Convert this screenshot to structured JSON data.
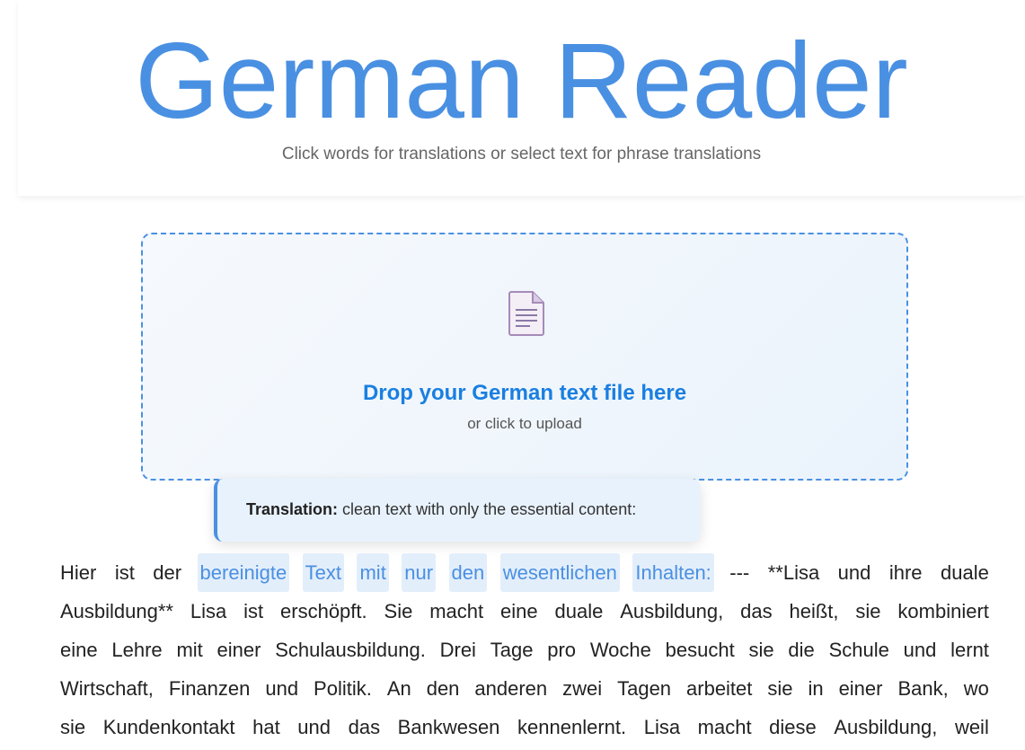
{
  "header": {
    "title": "German Reader",
    "subtitle": "Click words for translations or select text for phrase translations"
  },
  "upload": {
    "icon": "document-icon",
    "title": "Drop your German text file here",
    "subtitle": "or click to upload"
  },
  "tooltip": {
    "label": "Translation:",
    "text": " clean text with only the essential content:"
  },
  "reader": {
    "lines": [
      [
        {
          "w": "Hier",
          "hl": false
        },
        {
          "w": "ist",
          "hl": false
        },
        {
          "w": "der",
          "hl": false
        },
        {
          "w": "bereinigte",
          "hl": true
        },
        {
          "w": "Text",
          "hl": true
        },
        {
          "w": "mit",
          "hl": true
        },
        {
          "w": "nur",
          "hl": true
        },
        {
          "w": "den",
          "hl": true
        },
        {
          "w": "wesentlichen",
          "hl": true
        },
        {
          "w": "Inhalten:",
          "hl": true
        },
        {
          "w": "---",
          "hl": false
        },
        {
          "w": "**Lisa",
          "hl": false
        },
        {
          "w": "und",
          "hl": false
        },
        {
          "w": "ihre",
          "hl": false
        },
        {
          "w": "duale",
          "hl": false
        }
      ],
      [
        {
          "w": "Ausbildung**",
          "hl": false
        },
        {
          "w": "Lisa",
          "hl": false
        },
        {
          "w": "ist",
          "hl": false
        },
        {
          "w": "erschöpft.",
          "hl": false
        },
        {
          "w": "Sie",
          "hl": false
        },
        {
          "w": "macht",
          "hl": false
        },
        {
          "w": "eine",
          "hl": false
        },
        {
          "w": "duale",
          "hl": false
        },
        {
          "w": "Ausbildung,",
          "hl": false
        },
        {
          "w": "das",
          "hl": false
        },
        {
          "w": "heißt,",
          "hl": false
        },
        {
          "w": "sie",
          "hl": false
        },
        {
          "w": "kombiniert",
          "hl": false
        }
      ],
      [
        {
          "w": "eine",
          "hl": false
        },
        {
          "w": "Lehre",
          "hl": false
        },
        {
          "w": "mit",
          "hl": false
        },
        {
          "w": "einer",
          "hl": false
        },
        {
          "w": "Schulausbildung.",
          "hl": false
        },
        {
          "w": "Drei",
          "hl": false
        },
        {
          "w": "Tage",
          "hl": false
        },
        {
          "w": "pro",
          "hl": false
        },
        {
          "w": "Woche",
          "hl": false
        },
        {
          "w": "besucht",
          "hl": false
        },
        {
          "w": "sie",
          "hl": false
        },
        {
          "w": "die",
          "hl": false
        },
        {
          "w": "Schule",
          "hl": false
        },
        {
          "w": "und",
          "hl": false
        },
        {
          "w": "lernt",
          "hl": false
        }
      ],
      [
        {
          "w": "Wirtschaft,",
          "hl": false
        },
        {
          "w": "Finanzen",
          "hl": false
        },
        {
          "w": "und",
          "hl": false
        },
        {
          "w": "Politik.",
          "hl": false
        },
        {
          "w": "An",
          "hl": false
        },
        {
          "w": "den",
          "hl": false
        },
        {
          "w": "anderen",
          "hl": false
        },
        {
          "w": "zwei",
          "hl": false
        },
        {
          "w": "Tagen",
          "hl": false
        },
        {
          "w": "arbeitet",
          "hl": false
        },
        {
          "w": "sie",
          "hl": false
        },
        {
          "w": "in",
          "hl": false
        },
        {
          "w": "einer",
          "hl": false
        },
        {
          "w": "Bank,",
          "hl": false
        },
        {
          "w": "wo",
          "hl": false
        }
      ],
      [
        {
          "w": "sie",
          "hl": false
        },
        {
          "w": "Kundenkontakt",
          "hl": false
        },
        {
          "w": "hat",
          "hl": false
        },
        {
          "w": "und",
          "hl": false
        },
        {
          "w": "das",
          "hl": false
        },
        {
          "w": "Bankwesen",
          "hl": false
        },
        {
          "w": "kennenlernt.",
          "hl": false
        },
        {
          "w": "Lisa",
          "hl": false
        },
        {
          "w": "macht",
          "hl": false
        },
        {
          "w": "diese",
          "hl": false
        },
        {
          "w": "Ausbildung,",
          "hl": false
        },
        {
          "w": "weil",
          "hl": false
        }
      ]
    ]
  },
  "colors": {
    "accent": "#4a90e2",
    "highlight_bg": "#e3eefb",
    "upload_title": "#1a7fe0"
  }
}
